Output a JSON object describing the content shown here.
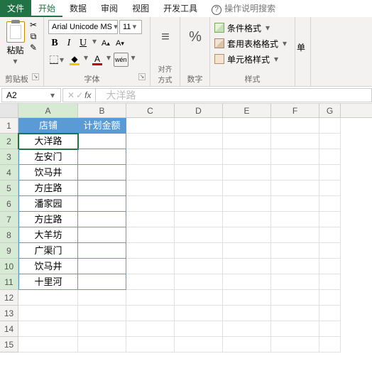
{
  "tabs": {
    "file": "文件",
    "home": "开始",
    "data": "数据",
    "review": "审阅",
    "view": "视图",
    "dev": "开发工具",
    "help": "操作说明搜索"
  },
  "clipboard": {
    "paste": "粘贴",
    "group": "剪贴板"
  },
  "font": {
    "name": "Arial Unicode MS",
    "size": "11",
    "group": "字体",
    "bold": "B",
    "italic": "I",
    "underline": "U",
    "incfont": "A",
    "decfont": "A",
    "fontcolor": "A",
    "wen": "wén"
  },
  "align": {
    "group": "对齐方式"
  },
  "number": {
    "symbol": "%",
    "group": "数字"
  },
  "styles": {
    "cond": "条件格式",
    "table": "套用表格格式",
    "cell": "单元格样式",
    "group": "样式"
  },
  "single": {
    "label": "单"
  },
  "fbar": {
    "namebox": "A2",
    "watermark": "大洋路"
  },
  "cols": [
    "A",
    "B",
    "C",
    "D",
    "E",
    "F",
    "G"
  ],
  "headers": {
    "a": "店铺",
    "b": "计划金额"
  },
  "rows": [
    "大洋路",
    "左安门",
    "饮马井",
    "方庄路",
    "潘家园",
    "方庄路",
    "大羊坊",
    "广渠门",
    "饮马井",
    "十里河"
  ]
}
